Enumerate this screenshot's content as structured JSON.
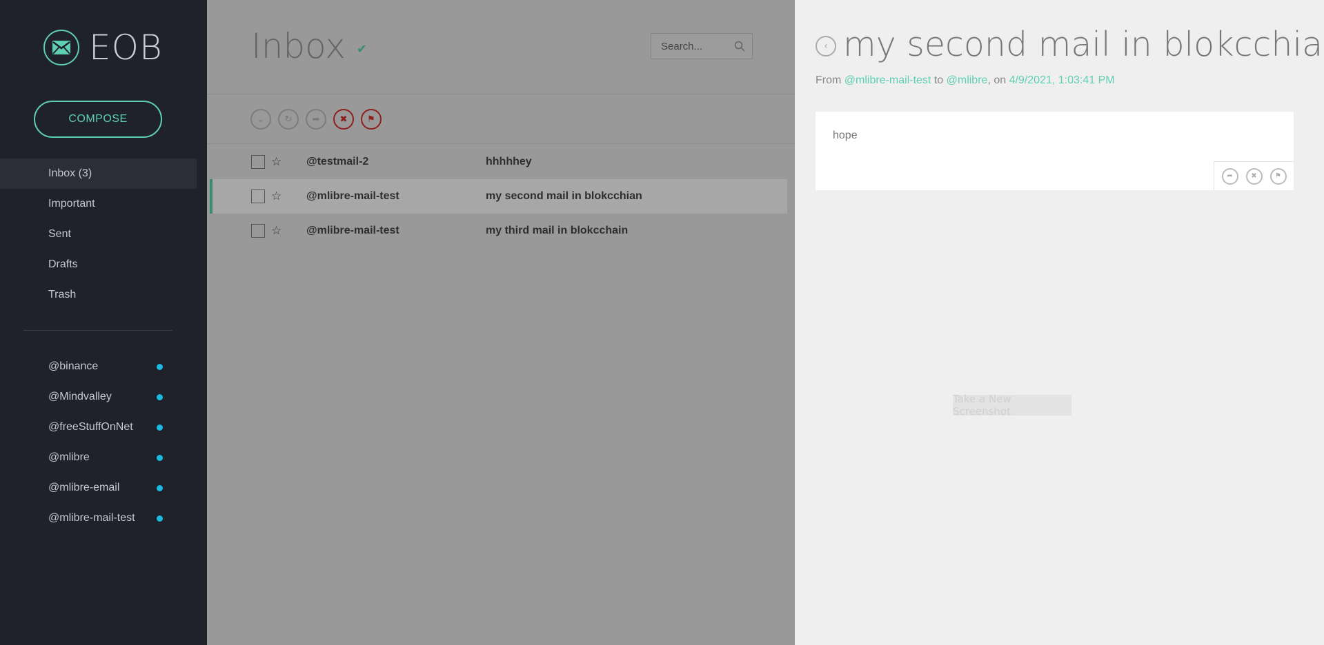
{
  "app": {
    "logo_text": "EOB"
  },
  "compose": {
    "label": "COMPOSE"
  },
  "nav": {
    "items": [
      {
        "label": "Inbox (3)",
        "active": true
      },
      {
        "label": "Important"
      },
      {
        "label": "Sent"
      },
      {
        "label": "Drafts"
      },
      {
        "label": "Trash"
      }
    ]
  },
  "contacts": [
    {
      "name": "@binance"
    },
    {
      "name": "@Mindvalley"
    },
    {
      "name": "@freeStuffOnNet"
    },
    {
      "name": "@mlibre"
    },
    {
      "name": "@mlibre-email"
    },
    {
      "name": "@mlibre-mail-test"
    }
  ],
  "inbox": {
    "title": "Inbox",
    "search_placeholder": "Search...",
    "toolbar": [
      "select-icon",
      "refresh-icon",
      "forward-icon",
      "delete-icon",
      "flag-icon"
    ],
    "rows": [
      {
        "sender": "@testmail-2",
        "subject": "hhhhhey"
      },
      {
        "sender": "@mlibre-mail-test",
        "subject": "my second mail in blokcchian",
        "selected": true
      },
      {
        "sender": "@mlibre-mail-test",
        "subject": "my third mail in blokcchain"
      }
    ]
  },
  "detail": {
    "title": "my second mail in blokcchian",
    "from_label": "From",
    "from": "@mlibre-mail-test",
    "to_label": "to",
    "to": "@mlibre",
    "on_label": ", on",
    "date": "4/9/2021, 1:03:41 PM",
    "body": "hope",
    "screenshot_button": "Take a New Screenshot"
  },
  "colors": {
    "accent": "#5ecfb1",
    "sidebar": "#1f222b",
    "dot": "#1cb9e0",
    "danger": "#8f1f1f"
  }
}
